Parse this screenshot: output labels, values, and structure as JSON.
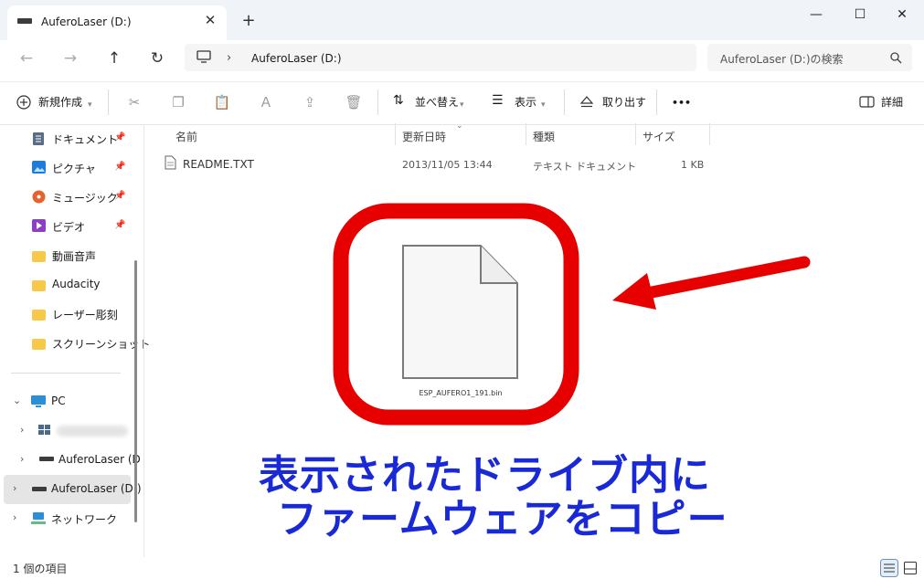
{
  "window": {
    "tab_title": "AuferoLaser (D:)",
    "new_tab": "+",
    "close_tab": "✕",
    "minimize": "—",
    "maximize": "☐",
    "close": "✕"
  },
  "address": {
    "path": "AuferoLaser (D:)",
    "separator": "›",
    "search_placeholder": "AuferoLaser (D:)の検索"
  },
  "toolbar": {
    "new": "新規作成",
    "sort": "並べ替え",
    "view": "表示",
    "eject": "取り出す",
    "more": "•••",
    "details": "詳細"
  },
  "sidebar": {
    "quick": [
      {
        "label": "ドキュメント",
        "icon": "document-icon",
        "pinned": true
      },
      {
        "label": "ピクチャ",
        "icon": "pictures-icon",
        "pinned": true
      },
      {
        "label": "ミュージック",
        "icon": "music-icon",
        "pinned": true
      },
      {
        "label": "ビデオ",
        "icon": "video-icon",
        "pinned": true
      },
      {
        "label": "動画音声",
        "icon": "folder-icon",
        "pinned": false
      },
      {
        "label": "Audacity",
        "icon": "folder-icon",
        "pinned": false
      },
      {
        "label": "レーザー彫刻",
        "icon": "folder-icon",
        "pinned": false
      },
      {
        "label": "スクリーンショット",
        "icon": "folder-icon",
        "pinned": false
      }
    ],
    "pc": "PC",
    "drive1": "AuferoLaser (D",
    "drive_selected": "AuferoLaser (D:)",
    "network": "ネットワーク"
  },
  "columns": {
    "name": "名前",
    "date": "更新日時",
    "type": "種類",
    "size": "サイズ"
  },
  "files": [
    {
      "name": "README.TXT",
      "date": "2013/11/05 13:44",
      "type": "テキスト ドキュメント",
      "size": "1 KB"
    }
  ],
  "overlay": {
    "file_label": "ESP_AUFERO1_191.bin",
    "line1": "表示されたドライブ内に",
    "line2": "ファームウェアをコピー",
    "annotation_color": "#1a29d6",
    "highlight_color": "#e60000"
  },
  "status": {
    "count": "1 個の項目"
  }
}
